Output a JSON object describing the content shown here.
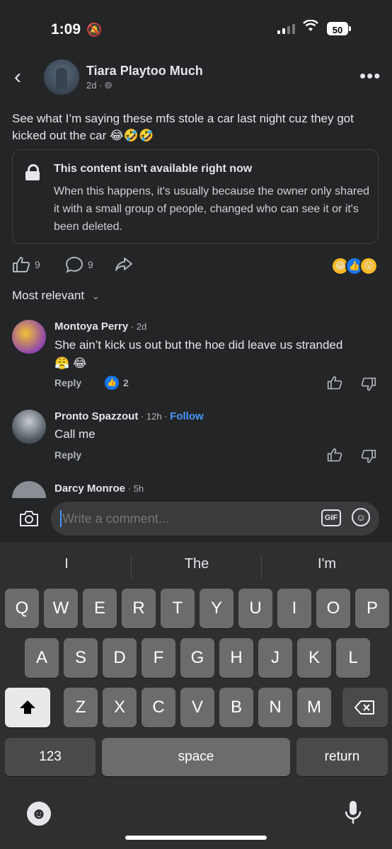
{
  "status_bar": {
    "time": "1:09",
    "battery": "50"
  },
  "post": {
    "author": "Tiara Playtoo Much",
    "age": "2d",
    "text": "See what I’m saying these mfs stole a car last night cuz they got kicked out the car",
    "text_emoji": "😂🤣🤣",
    "unavailable": {
      "title": "This content isn't available right now",
      "body": "When this happens, it's usually because the owner only shared it with a small group of people, changed who can see it or it's been deleted."
    },
    "likes": "9",
    "comments": "9",
    "reaction_emojis": [
      "😂",
      "👍",
      "😮"
    ]
  },
  "sort": {
    "label": "Most relevant"
  },
  "comments": [
    {
      "name": "Montoya Perry",
      "time": "2d",
      "text": "She ain’t kick us out but the hoe did leave us stranded",
      "emoji": "😤 😂",
      "reply": "Reply",
      "reactions": "2"
    },
    {
      "name": "Pronto Spazzout",
      "time": "12h",
      "follow": "Follow",
      "text": "Call me",
      "reply": "Reply"
    },
    {
      "name": "Darcy Monroe",
      "time": "5h"
    }
  ],
  "composer": {
    "placeholder": "Write a comment...",
    "gif_label": "GIF"
  },
  "keyboard": {
    "suggestions": [
      "I",
      "The",
      "I'm"
    ],
    "row1": [
      "Q",
      "W",
      "E",
      "R",
      "T",
      "Y",
      "U",
      "I",
      "O",
      "P"
    ],
    "row2": [
      "A",
      "S",
      "D",
      "F",
      "G",
      "H",
      "J",
      "K",
      "L"
    ],
    "row3": [
      "Z",
      "X",
      "C",
      "V",
      "B",
      "N",
      "M"
    ],
    "numbers_label": "123",
    "space_label": "space",
    "return_label": "return"
  }
}
